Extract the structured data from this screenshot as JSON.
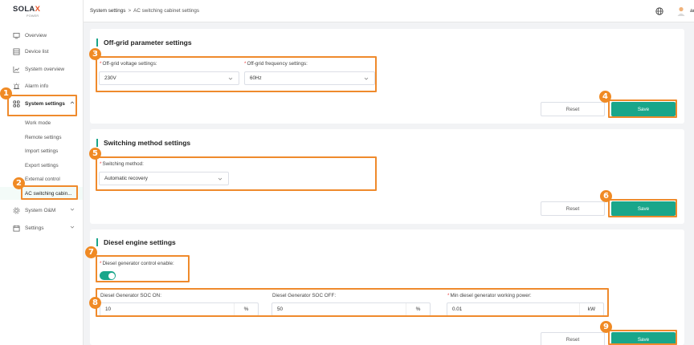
{
  "logo": {
    "brand_prefix": "SOLA",
    "brand_x": "X",
    "sub": "POWER"
  },
  "sidebar": {
    "items": [
      {
        "label": "Overview",
        "icon": "monitor-icon"
      },
      {
        "label": "Device list",
        "icon": "device-list-icon"
      },
      {
        "label": "System overview",
        "icon": "line-chart-icon"
      },
      {
        "label": "Alarm info",
        "icon": "alarm-icon"
      },
      {
        "label": "System settings",
        "icon": "grid-settings-icon"
      },
      {
        "label": "System O&M",
        "icon": "om-icon"
      },
      {
        "label": "Settings",
        "icon": "settings-folder-icon"
      }
    ],
    "sub_items": [
      {
        "label": "Work mode"
      },
      {
        "label": "Remote settings"
      },
      {
        "label": "Import settings"
      },
      {
        "label": "Export settings"
      },
      {
        "label": "External control"
      },
      {
        "label": "AC switching cabin..."
      }
    ]
  },
  "header": {
    "breadcrumb_root": "System settings",
    "breadcrumb_sep": ">",
    "breadcrumb_current": "AC switching cabinet settings",
    "user_name": "admin",
    "user_caret": "˅"
  },
  "offgrid": {
    "title": "Off-grid parameter settings",
    "voltage_label": "Off-grid voltage settings:",
    "voltage_value": "230V",
    "frequency_label": "Off-grid frequency settings:",
    "frequency_value": "60Hz",
    "reset_label": "Reset",
    "save_label": "Save"
  },
  "switching": {
    "title": "Switching method settings",
    "method_label": "Switching method:",
    "method_value": "Automatic recovery",
    "reset_label": "Reset",
    "save_label": "Save"
  },
  "diesel": {
    "title": "Diesel engine settings",
    "enable_label": "Diesel generator control enable:",
    "enable_state": true,
    "soc_on_label": "Diesel Generator SOC ON:",
    "soc_on_value": "10",
    "soc_on_unit": "%",
    "soc_off_label": "Diesel Generator SOC OFF:",
    "soc_off_value": "50",
    "soc_off_unit": "%",
    "min_power_label": "Min diesel generator working power:",
    "min_power_value": "0.01",
    "min_power_unit": "kW",
    "reset_label": "Reset",
    "save_label": "Save"
  },
  "required_mark": "*",
  "annotations": [
    "1",
    "2",
    "3",
    "4",
    "5",
    "6",
    "7",
    "8",
    "9"
  ],
  "colors": {
    "accent": "#19a68a",
    "highlight": "#ef8a2c",
    "badge": "#f08a24",
    "required": "#ee4444"
  }
}
